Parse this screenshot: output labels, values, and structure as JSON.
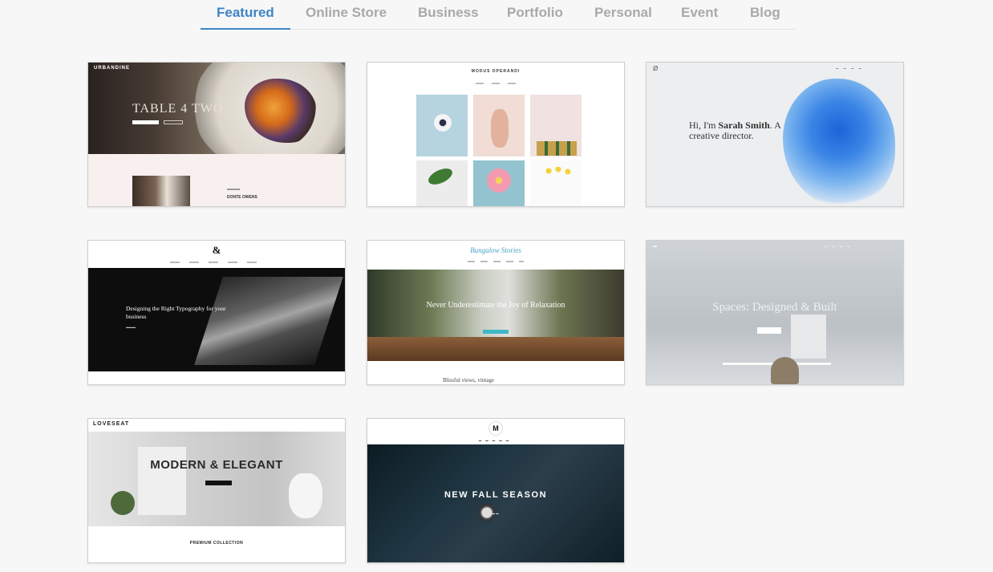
{
  "tabs": {
    "items": [
      {
        "label": "Featured",
        "active": true
      },
      {
        "label": "Online Store",
        "active": false
      },
      {
        "label": "Business",
        "active": false
      },
      {
        "label": "Portfolio",
        "active": false
      },
      {
        "label": "Personal",
        "active": false
      },
      {
        "label": "Event",
        "active": false
      },
      {
        "label": "Blog",
        "active": false
      }
    ],
    "active_color": "#3d84c6",
    "inactive_color": "#a9a9a9"
  },
  "templates": [
    {
      "brand": "URBANDINE",
      "headline": "TABLE 4 TWO",
      "person_name": "DONTE OWENS"
    },
    {
      "brand": "MODUS OPERANDI"
    },
    {
      "logo": "Ø",
      "headline_prefix": "Hi, I'm ",
      "headline_name": "Sarah Smith",
      "headline_suffix": ". A creative director."
    },
    {
      "logo": "&",
      "headline": "Designing the Right Typography for your business"
    },
    {
      "brand": "Bungalow Stories",
      "headline": "Never Underestimate the Joy of Relaxation",
      "subheadline": "Blissful views, vintage"
    },
    {
      "headline": "Spaces: Designed & Built"
    },
    {
      "brand": "LOVESEAT",
      "headline": "MODERN & ELEGANT",
      "subheadline": "PREMIUM COLLECTION"
    },
    {
      "logo": "M",
      "headline": "NEW FALL SEASON"
    }
  ]
}
